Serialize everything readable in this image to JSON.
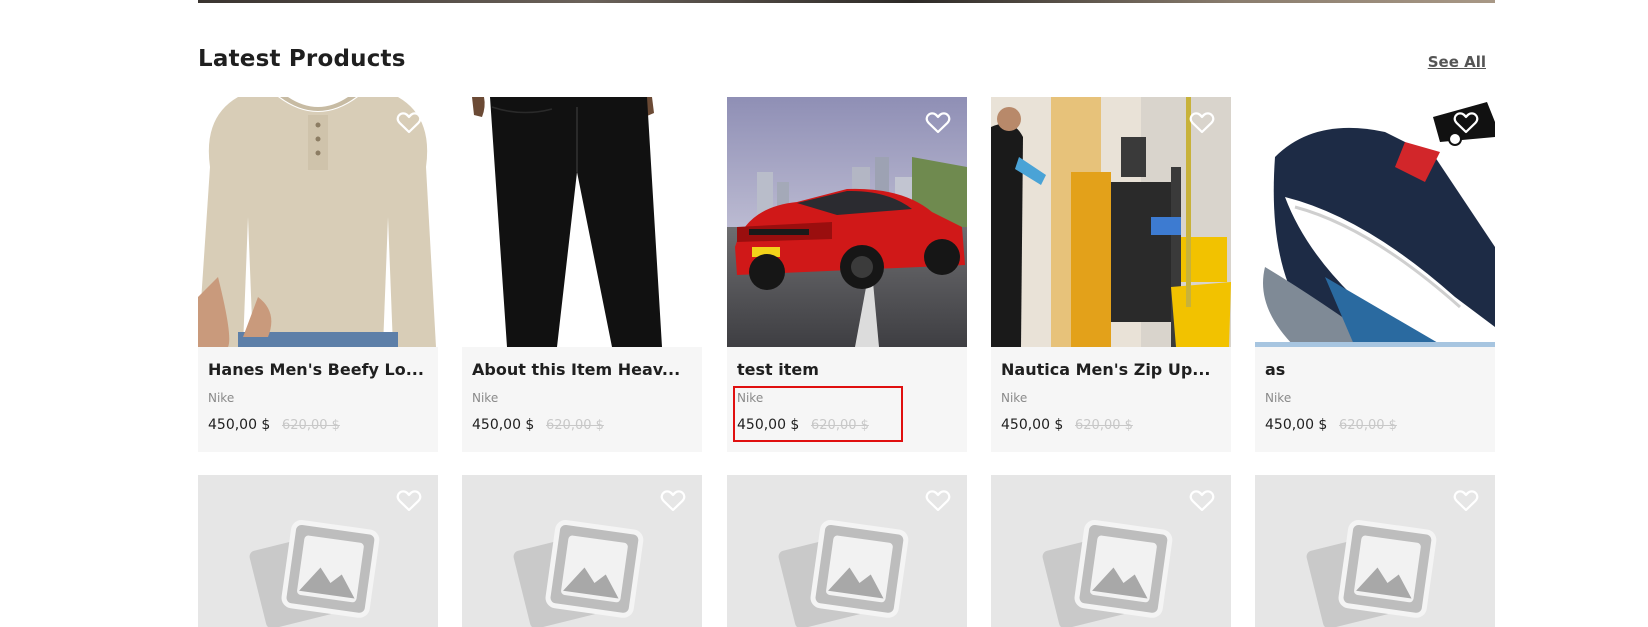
{
  "section": {
    "title": "Latest Products",
    "see_all": "See All"
  },
  "products": [
    {
      "name": "Hanes Men's Beefy Lo...",
      "brand": "Nike",
      "price": "450,00 $",
      "old_price": "620,00 $",
      "image": "long-sleeve-henley-shirt"
    },
    {
      "name": "About this Item Heav...",
      "brand": "Nike",
      "price": "450,00 $",
      "old_price": "620,00 $",
      "image": "black-pants"
    },
    {
      "name": "test item",
      "brand": "Nike",
      "price": "450,00 $",
      "old_price": "620,00 $",
      "image": "red-sports-car"
    },
    {
      "name": "Nautica Men's Zip Up...",
      "brand": "Nike",
      "price": "450,00 $",
      "old_price": "620,00 $",
      "image": "cleaning-cart"
    },
    {
      "name": "as",
      "brand": "Nike",
      "price": "450,00 $",
      "old_price": "620,00 $",
      "image": "vans-sneakers"
    }
  ],
  "placeholder_icon": "image-placeholder-icon",
  "heart_icon": "heart-outline-icon",
  "colors": {
    "highlight": "#e01010",
    "card_bg": "#f6f6f6",
    "placeholder_bg": "#e6e6e6"
  }
}
